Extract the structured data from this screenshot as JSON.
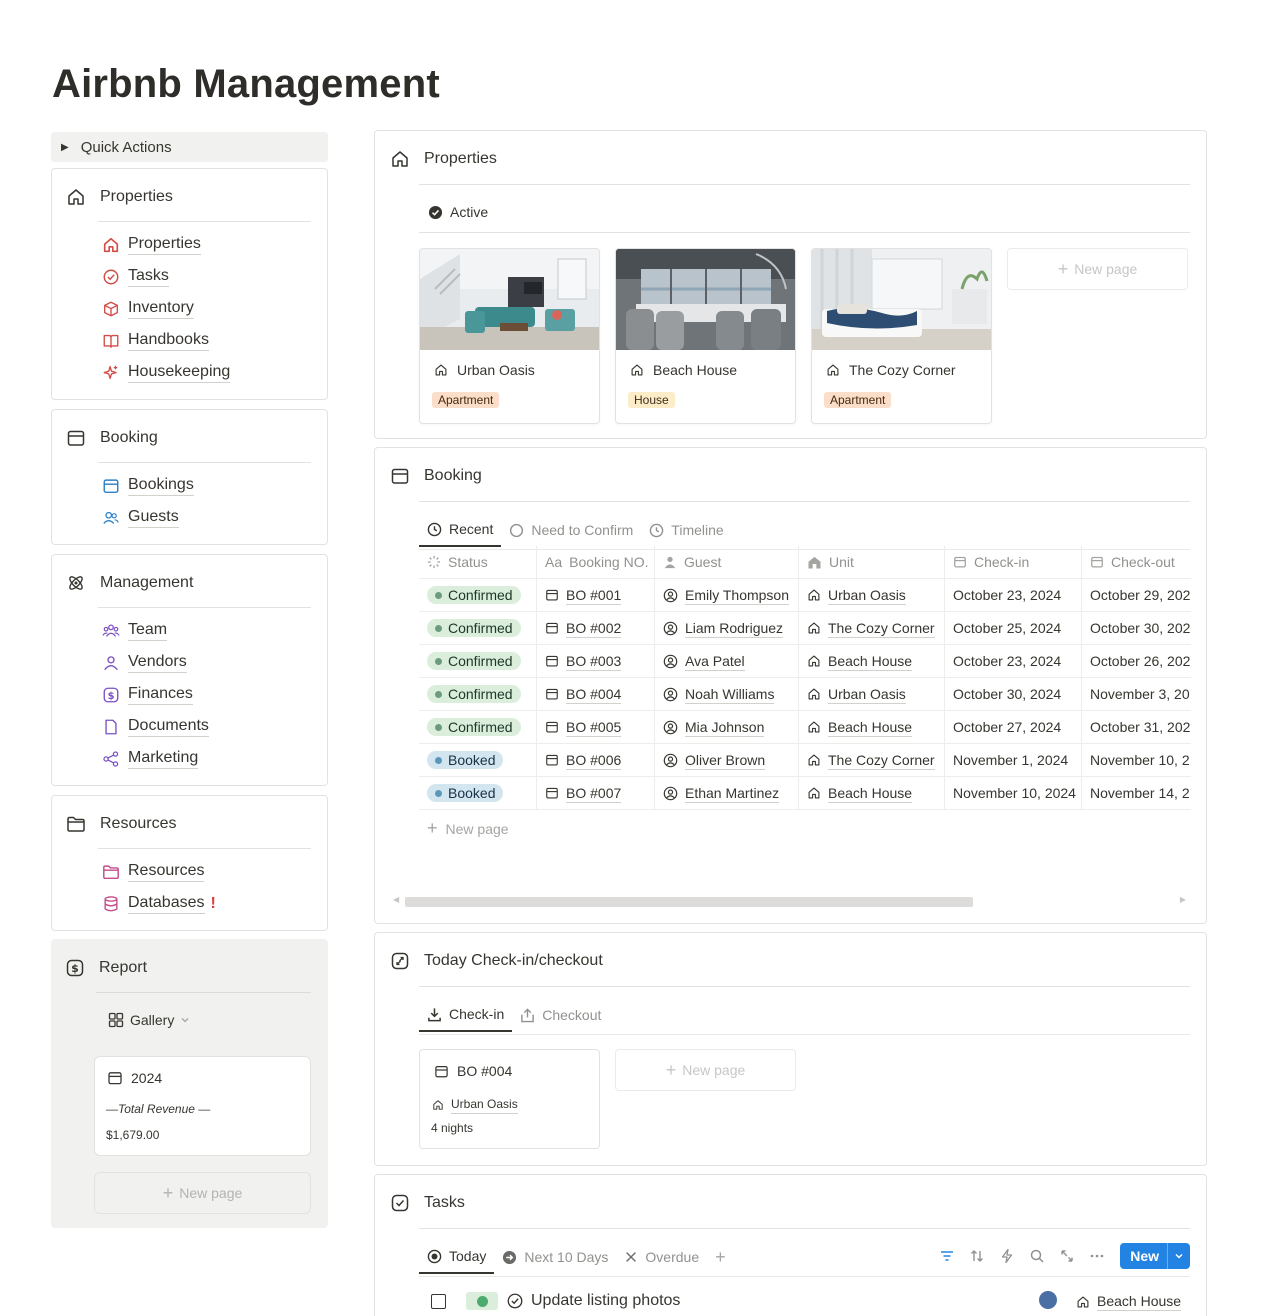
{
  "page_title": "Airbnb Management",
  "quick_actions": "Quick Actions",
  "sidebar": {
    "properties": {
      "title": "Properties",
      "items": [
        "Properties",
        "Tasks",
        "Inventory",
        "Handbooks",
        "Housekeeping"
      ]
    },
    "booking": {
      "title": "Booking",
      "items": [
        "Bookings",
        "Guests"
      ]
    },
    "management": {
      "title": "Management",
      "items": [
        "Team",
        "Vendors",
        "Finances",
        "Documents",
        "Marketing"
      ]
    },
    "resources": {
      "title": "Resources",
      "items": [
        "Resources",
        "Databases"
      ],
      "alert": "!"
    },
    "report": {
      "title": "Report",
      "view": "Gallery",
      "card": {
        "year": "2024",
        "label": "—Total Revenue —",
        "value": "$1,679.00"
      },
      "new_page": "New page"
    }
  },
  "properties_panel": {
    "title": "Properties",
    "view": "Active",
    "cards": [
      {
        "name": "Urban Oasis",
        "tag": "Apartment"
      },
      {
        "name": "Beach House",
        "tag": "House"
      },
      {
        "name": "The Cozy Corner",
        "tag": "Apartment"
      }
    ],
    "new_page": "New page"
  },
  "booking_panel": {
    "title": "Booking",
    "tabs": [
      "Recent",
      "Need to Confirm",
      "Timeline"
    ],
    "columns": [
      "Status",
      "Booking NO.",
      "Guest",
      "Unit",
      "Check-in",
      "Check-out"
    ],
    "col_prefix": "Aa",
    "rows": [
      {
        "status": "Confirmed",
        "no": "BO #001",
        "guest": "Emily Thompson",
        "unit": "Urban Oasis",
        "in": "October 23, 2024",
        "out": "October 29, 202"
      },
      {
        "status": "Confirmed",
        "no": "BO #002",
        "guest": "Liam Rodriguez",
        "unit": "The Cozy Corner",
        "in": "October 25, 2024",
        "out": "October 30, 202"
      },
      {
        "status": "Confirmed",
        "no": "BO #003",
        "guest": "Ava Patel",
        "unit": "Beach House",
        "in": "October 23, 2024",
        "out": "October 26, 202"
      },
      {
        "status": "Confirmed",
        "no": "BO #004",
        "guest": "Noah Williams",
        "unit": "Urban Oasis",
        "in": "October 30, 2024",
        "out": "November 3, 20"
      },
      {
        "status": "Confirmed",
        "no": "BO #005",
        "guest": "Mia Johnson",
        "unit": "Beach House",
        "in": "October 27, 2024",
        "out": "October 31, 202"
      },
      {
        "status": "Booked",
        "no": "BO #006",
        "guest": "Oliver Brown",
        "unit": "The Cozy Corner",
        "in": "November 1, 2024",
        "out": "November 10, 2"
      },
      {
        "status": "Booked",
        "no": "BO #007",
        "guest": "Ethan Martinez",
        "unit": "Beach House",
        "in": "November 10, 2024",
        "out": "November 14, 2"
      }
    ],
    "new_page": "New page"
  },
  "today_panel": {
    "title": "Today Check-in/checkout",
    "tabs": [
      "Check-in",
      "Checkout"
    ],
    "card": {
      "no": "BO #004",
      "unit": "Urban Oasis",
      "nights": "4 nights"
    },
    "new_page": "New page"
  },
  "tasks_panel": {
    "title": "Tasks",
    "tabs": [
      "Today",
      "Next 10 Days",
      "Overdue"
    ],
    "new_button": "New",
    "task": {
      "title": "Update listing photos",
      "unit": "Beach House"
    }
  },
  "colors": {
    "accent": "#2383e2",
    "alert": "#e03e3e",
    "confirmed_bg": "#dbeddb",
    "booked_bg": "#d3e5ef"
  }
}
